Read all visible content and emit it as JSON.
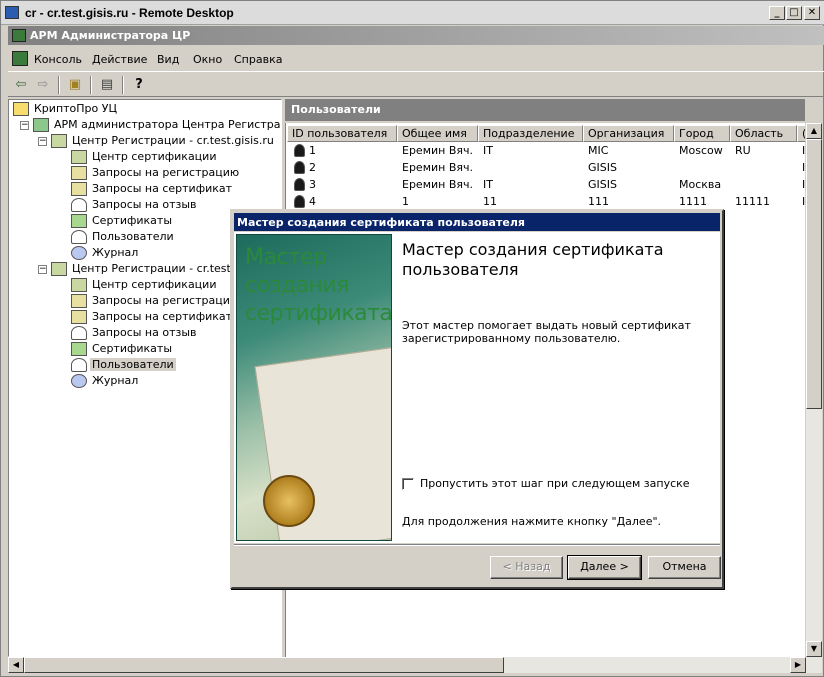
{
  "rdp": {
    "title": "cr - cr.test.gisis.ru - Remote Desktop",
    "min": "_",
    "max": "□",
    "close": "✕"
  },
  "mmc": {
    "title": "АРМ Администратора ЦР"
  },
  "menu": [
    "Консоль",
    "Действие",
    "Вид",
    "Окно",
    "Справка"
  ],
  "toolbar": {
    "back": "⇦",
    "forward": "⇨",
    "up": "▣",
    "export": "▤",
    "help": "?"
  },
  "tree": {
    "root": "КриптоПро УЦ",
    "admin": "АРМ администратора Центра Регистрации",
    "center1": "Центр Регистрации - cr.test.gisis.ru",
    "center1_items": [
      "Центр сертификации",
      "Запросы на регистрацию",
      "Запросы на сертификат",
      "Запросы на отзыв",
      "Сертификаты",
      "Пользователи",
      "Журнал"
    ],
    "center2": "Центр Регистрации - cr.test.gis",
    "center2_items": [
      "Центр сертификации",
      "Запросы на регистрацию",
      "Запросы на сертификат",
      "Запросы на отзыв",
      "Сертификаты",
      "Пользователи",
      "Журнал"
    ]
  },
  "pane_title": "Пользователи",
  "columns": [
    "ID пользователя",
    "Общее имя",
    "Подразделение",
    "Организация",
    "Город",
    "Область",
    "("
  ],
  "rows": [
    [
      "1",
      "Еремин Вяч...",
      "IT",
      "MIC",
      "Moscow",
      "RU",
      "I"
    ],
    [
      "2",
      "Еремин Вяч...",
      "",
      "GISIS",
      "",
      "",
      "I"
    ],
    [
      "3",
      "Еремин Вяч...",
      "IT",
      "GISIS",
      "Москва",
      "",
      "I"
    ],
    [
      "4",
      "1",
      "11",
      "111",
      "1111",
      "11111",
      "I"
    ]
  ],
  "wizard": {
    "title": "Мастер создания сертификата пользователя",
    "art_lines": [
      "Мастер",
      "создания",
      "сертификата"
    ],
    "heading": "Мастер создания сертификата пользователя",
    "description": "Этот мастер помогает выдать новый сертификат зарегистрированному пользователю.",
    "checkbox_label": "Пропустить этот шаг при следующем запуске",
    "checkbox_checked": false,
    "continue_text": "Для продолжения нажмите кнопку \"Далее\".",
    "back_label": "< Назад",
    "next_label": "Далее >",
    "cancel_label": "Отмена"
  }
}
